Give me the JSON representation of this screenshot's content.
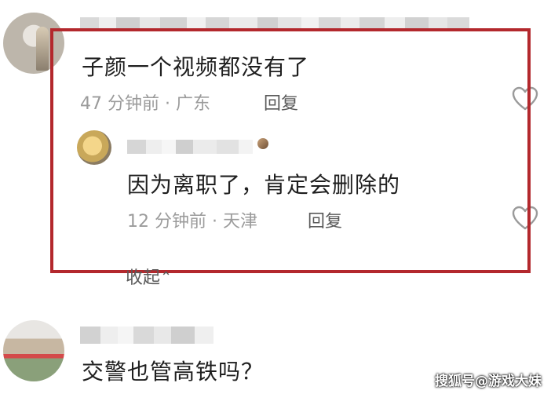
{
  "comments": [
    {
      "text": "子颜一个视频都没有了",
      "time": "47 分钟前",
      "location": "广东",
      "reply_label": "回复"
    },
    {
      "text": "因为离职了，肯定会删除的",
      "time": "12 分钟前",
      "location": "天津",
      "reply_label": "回复"
    },
    {
      "text": "交警也管高铁吗？"
    }
  ],
  "meta_separator": "·",
  "collapse_label": "收起",
  "collapse_icon": "chevron-up-icon",
  "watermark": "搜狐号@游戏大妹",
  "colors": {
    "highlight_border": "#b3282d",
    "meta_text": "#9b9b9b",
    "comment_text": "#1f1f1f"
  }
}
